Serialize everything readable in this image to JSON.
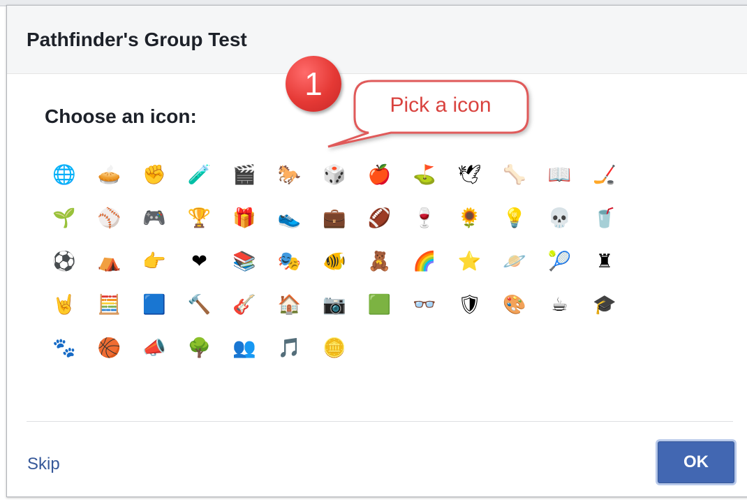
{
  "dialog": {
    "title": "Pathfinder's Group Test",
    "prompt": "Choose an icon:"
  },
  "icons": [
    {
      "name": "globe-icon",
      "glyph": "🌐"
    },
    {
      "name": "pie-chart-icon",
      "glyph": "🥧"
    },
    {
      "name": "fist-icon",
      "glyph": "✊"
    },
    {
      "name": "flask-icon",
      "glyph": "🧪"
    },
    {
      "name": "clapperboard-icon",
      "glyph": "🎬"
    },
    {
      "name": "horse-icon",
      "glyph": "🐎"
    },
    {
      "name": "dice-icon",
      "glyph": "🎲"
    },
    {
      "name": "apple-icon",
      "glyph": "🍎"
    },
    {
      "name": "golf-ball-icon",
      "glyph": "⛳"
    },
    {
      "name": "dove-icon",
      "glyph": "🕊"
    },
    {
      "name": "bone-icon",
      "glyph": "🦴"
    },
    {
      "name": "book-icon",
      "glyph": "📖"
    },
    {
      "name": "hockey-puck-icon",
      "glyph": "🏒"
    },
    {
      "name": "potted-plant-icon",
      "glyph": "🌱"
    },
    {
      "name": "baseball-icon",
      "glyph": "⚾"
    },
    {
      "name": "game-controller-icon",
      "glyph": "🎮"
    },
    {
      "name": "trophy-icon",
      "glyph": "🏆"
    },
    {
      "name": "gift-icon",
      "glyph": "🎁"
    },
    {
      "name": "sneaker-icon",
      "glyph": "👟"
    },
    {
      "name": "briefcase-icon",
      "glyph": "💼"
    },
    {
      "name": "football-icon",
      "glyph": "🏈"
    },
    {
      "name": "wine-glass-icon",
      "glyph": "🍷"
    },
    {
      "name": "sunflower-icon",
      "glyph": "🌻"
    },
    {
      "name": "lightbulb-icon",
      "glyph": "💡"
    },
    {
      "name": "skull-icon",
      "glyph": "💀"
    },
    {
      "name": "red-cup-icon",
      "glyph": "🥤"
    },
    {
      "name": "soccer-ball-icon",
      "glyph": "⚽"
    },
    {
      "name": "tent-icon",
      "glyph": "⛺"
    },
    {
      "name": "pointing-hand-icon",
      "glyph": "👉"
    },
    {
      "name": "heart-icon",
      "glyph": "❤"
    },
    {
      "name": "bookshelf-icon",
      "glyph": "📚"
    },
    {
      "name": "theater-masks-icon",
      "glyph": "🎭"
    },
    {
      "name": "fishbowl-icon",
      "glyph": "🐠"
    },
    {
      "name": "teddy-bear-icon",
      "glyph": "🧸"
    },
    {
      "name": "rainbow-icon",
      "glyph": "🌈"
    },
    {
      "name": "star-badge-icon",
      "glyph": "⭐"
    },
    {
      "name": "planet-icon",
      "glyph": "🪐"
    },
    {
      "name": "tennis-ball-icon",
      "glyph": "🎾"
    },
    {
      "name": "chess-rook-icon",
      "glyph": "♜"
    },
    {
      "name": "rock-hand-icon",
      "glyph": "🤘"
    },
    {
      "name": "calculator-icon",
      "glyph": "🧮"
    },
    {
      "name": "blue-square-icon",
      "glyph": "🟦"
    },
    {
      "name": "gavel-icon",
      "glyph": "🔨"
    },
    {
      "name": "guitar-icon",
      "glyph": "🎸"
    },
    {
      "name": "house-icon",
      "glyph": "🏠"
    },
    {
      "name": "camera-icon",
      "glyph": "📷"
    },
    {
      "name": "microchip-icon",
      "glyph": "🟩"
    },
    {
      "name": "glasses-icon",
      "glyph": "👓"
    },
    {
      "name": "shield-icon",
      "glyph": "🛡"
    },
    {
      "name": "palette-icon",
      "glyph": "🎨"
    },
    {
      "name": "coffee-mug-icon",
      "glyph": "☕"
    },
    {
      "name": "graduation-cap-icon",
      "glyph": "🎓"
    },
    {
      "name": "paw-icon",
      "glyph": "🐾"
    },
    {
      "name": "basketball-icon",
      "glyph": "🏀"
    },
    {
      "name": "megaphone-icon",
      "glyph": "📣"
    },
    {
      "name": "tree-icon",
      "glyph": "🌳"
    },
    {
      "name": "people-icon",
      "glyph": "👥"
    },
    {
      "name": "music-notes-icon",
      "glyph": "🎵"
    },
    {
      "name": "coin-icon",
      "glyph": "🪙"
    }
  ],
  "footer": {
    "skip_label": "Skip",
    "ok_label": "OK"
  },
  "annotation": {
    "step_number": "1",
    "callout_text": "Pick a icon"
  },
  "colors": {
    "ok_button": "#4267b2",
    "link": "#365899",
    "annotation_red": "#e53935",
    "callout_border": "#e05a5a"
  }
}
